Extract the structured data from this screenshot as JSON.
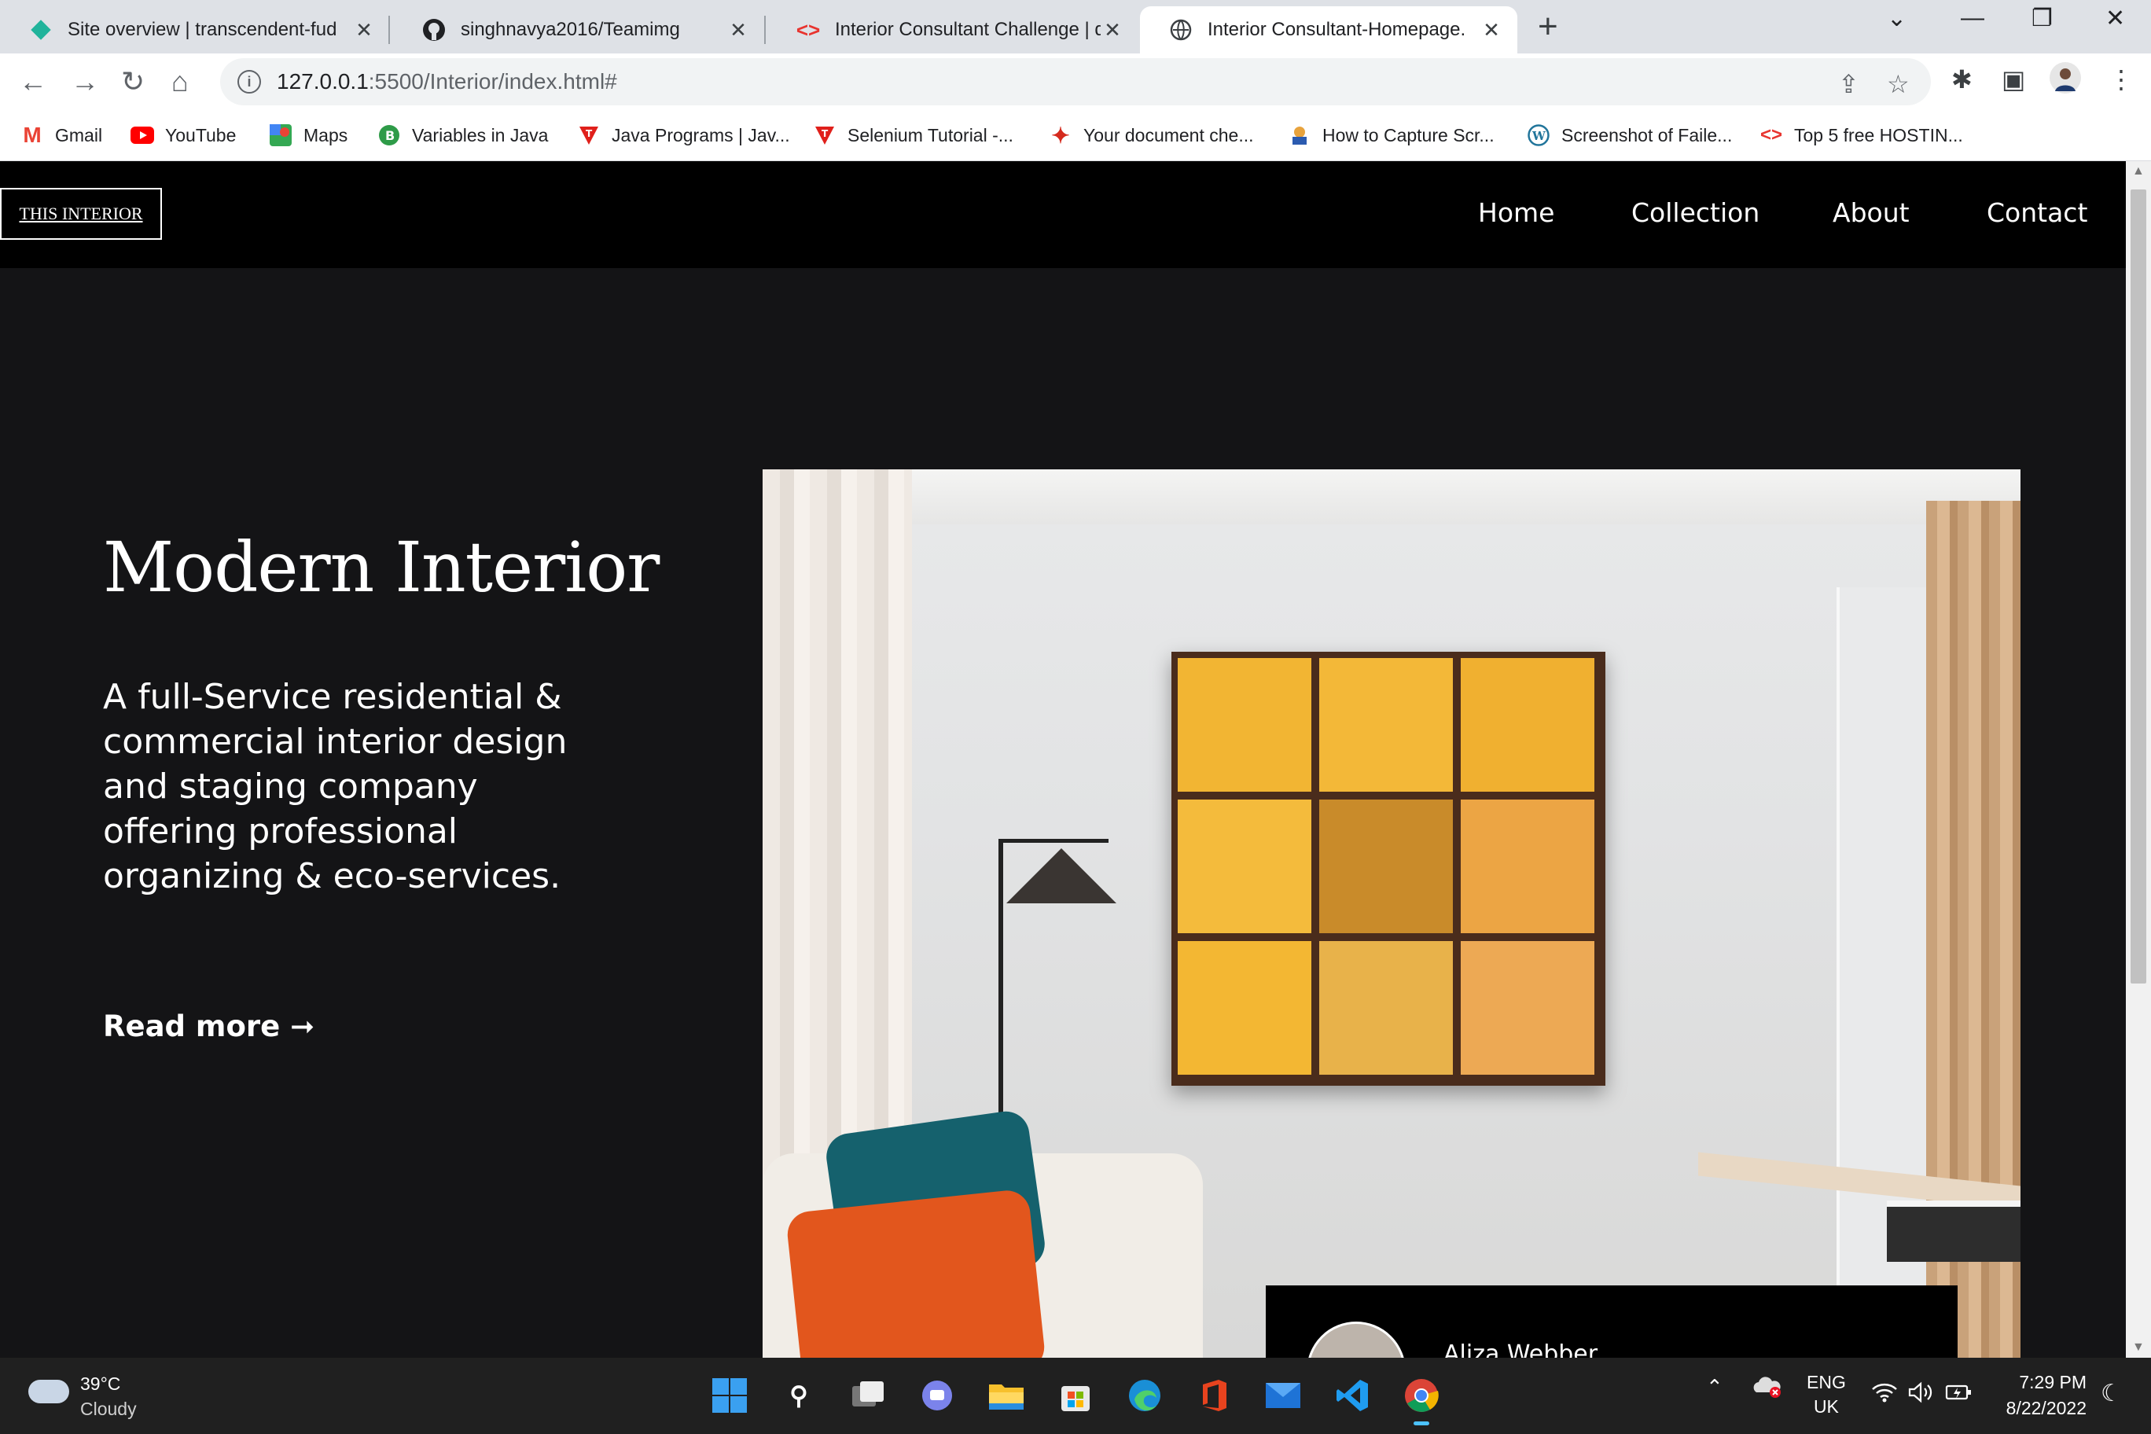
{
  "browser": {
    "tabs": [
      {
        "title": "Site overview | transcendent-fud",
        "icon": "netlify-icon",
        "active": false
      },
      {
        "title": "singhnavya2016/Teamimg",
        "icon": "github-icon",
        "active": false
      },
      {
        "title": "Interior Consultant Challenge | de",
        "icon": "codecademy-icon",
        "active": false
      },
      {
        "title": "Interior Consultant-Homepage.",
        "icon": "globe-icon",
        "active": true
      }
    ],
    "url_host": "127.0.0.1",
    "url_path": ":5500/Interior/index.html#",
    "bookmarks": [
      {
        "label": "Gmail",
        "icon": "gmail-icon"
      },
      {
        "label": "YouTube",
        "icon": "youtube-icon"
      },
      {
        "label": "Maps",
        "icon": "maps-icon"
      },
      {
        "label": "Variables in Java",
        "icon": "bookmark-icon"
      },
      {
        "label": "Java Programs | Jav...",
        "icon": "bookmark-icon"
      },
      {
        "label": "Selenium Tutorial -...",
        "icon": "bookmark-icon"
      },
      {
        "label": "Your document che...",
        "icon": "maple-leaf-icon"
      },
      {
        "label": "How to Capture Scr...",
        "icon": "bookmark-icon"
      },
      {
        "label": "Screenshot of Faile...",
        "icon": "wordpress-icon"
      },
      {
        "label": "Top 5 free HOSTIN...",
        "icon": "bookmark-icon"
      }
    ]
  },
  "site": {
    "logo": "THIS INTERIOR",
    "nav": [
      "Home",
      "Collection",
      "About",
      "Contact"
    ],
    "hero": {
      "title": "Modern Interior",
      "text": "A full-Service residential & commercial interior design and staging company offering professional organizing & eco-services.",
      "cta": "Read more ➞"
    },
    "testimonial": {
      "name": "Aliza Webber"
    }
  },
  "taskbar": {
    "weather_temp": "39°C",
    "weather_condition": "Cloudy",
    "language": "ENG",
    "region": "UK",
    "time": "7:29 PM",
    "date": "8/22/2022"
  },
  "colors": {
    "page_bg": "#141416",
    "header_bg": "#000000",
    "text": "#ffffff"
  }
}
